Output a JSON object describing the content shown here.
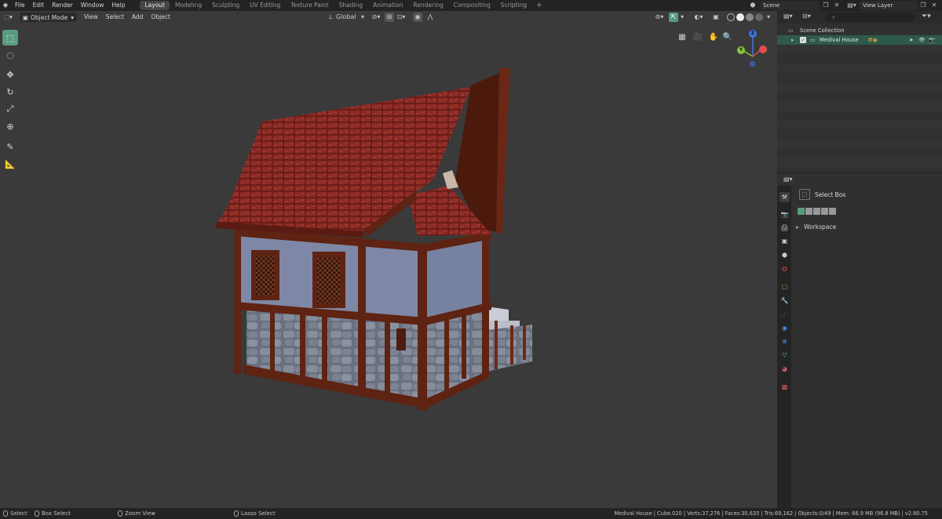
{
  "topbar": {
    "menus": [
      "File",
      "Edit",
      "Render",
      "Window",
      "Help"
    ],
    "workspaces": [
      {
        "label": "Layout",
        "active": true
      },
      {
        "label": "Modeling",
        "active": false
      },
      {
        "label": "Sculpting",
        "active": false
      },
      {
        "label": "UV Editing",
        "active": false
      },
      {
        "label": "Texture Paint",
        "active": false
      },
      {
        "label": "Shading",
        "active": false
      },
      {
        "label": "Animation",
        "active": false
      },
      {
        "label": "Rendering",
        "active": false
      },
      {
        "label": "Compositing",
        "active": false
      },
      {
        "label": "Scripting",
        "active": false
      }
    ],
    "add_workspace": "+",
    "scene": "Scene",
    "view_layer": "View Layer"
  },
  "viewport": {
    "mode": "Object Mode",
    "menus": [
      "View",
      "Select",
      "Add",
      "Object"
    ],
    "transform_orientation": "Global",
    "gizmo": {
      "x": "X",
      "y": "Y",
      "z": "Z"
    }
  },
  "outliner": {
    "search_placeholder": "",
    "scene_collection": "Scene Collection",
    "object": "Medival House"
  },
  "properties": {
    "tool_name": "Select Box",
    "panel": "Workspace"
  },
  "statusbar": {
    "select": "Select",
    "box_select": "Box Select",
    "zoom_view": "Zoom View",
    "lasso_select": "Lasso Select",
    "stats": "Medival House | Cube.020 | Verts:37,276 | Faces:30,635 | Tris:69,162 | Objects:0/49 | Mem: 66.9 MB (96.8 MB) | v2.80.75"
  },
  "colors": {
    "accent": "#5a9b7e",
    "viewport_bg": "#3a3a3a",
    "roof": "#8a2a25",
    "plaster": "#7d87a4",
    "timber": "#5e2312",
    "stone": "#7b8294"
  }
}
